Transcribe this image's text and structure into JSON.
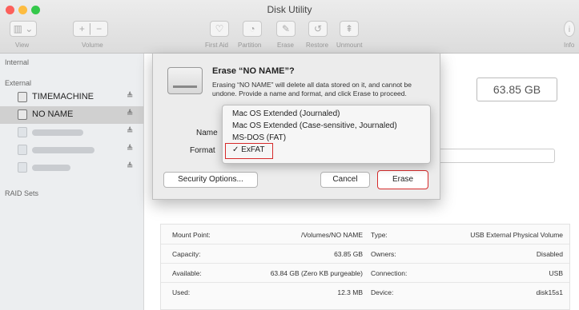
{
  "window": {
    "title": "Disk Utility"
  },
  "toolbar": {
    "view_label": "View",
    "volume_label": "Volume",
    "first_aid_label": "First Aid",
    "partition_label": "Partition",
    "erase_label": "Erase",
    "restore_label": "Restore",
    "unmount_label": "Unmount",
    "info_label": "Info"
  },
  "sidebar": {
    "internal_header": "Internal",
    "external_header": "External",
    "raid_header": "RAID Sets",
    "items": [
      {
        "label": "TIMEMACHINE"
      },
      {
        "label": "NO NAME"
      }
    ],
    "eject_glyph": "≜"
  },
  "main": {
    "capacity": "63.85 GB"
  },
  "dialog": {
    "title": "Erase “NO NAME”?",
    "body": "Erasing “NO NAME” will delete all data stored on it, and cannot be undone. Provide a name and format, and click Erase to proceed.",
    "name_label": "Name",
    "format_label": "Format",
    "security_button": "Security Options...",
    "cancel_button": "Cancel",
    "erase_button": "Erase"
  },
  "format_menu": {
    "options": [
      "Mac OS Extended (Journaled)",
      "Mac OS Extended (Case-sensitive, Journaled)",
      "MS-DOS (FAT)",
      "ExFAT"
    ],
    "selected": "ExFAT",
    "check_glyph": "✓"
  },
  "info": {
    "rows": [
      {
        "k1": "Mount Point:",
        "v1": "/Volumes/NO NAME",
        "k2": "Type:",
        "v2": "USB External Physical Volume"
      },
      {
        "k1": "Capacity:",
        "v1": "63.85 GB",
        "k2": "Owners:",
        "v2": "Disabled"
      },
      {
        "k1": "Available:",
        "v1": "63.84 GB (Zero KB purgeable)",
        "k2": "Connection:",
        "v2": "USB"
      },
      {
        "k1": "Used:",
        "v1": "12.3 MB",
        "k2": "Device:",
        "v2": "disk15s1"
      }
    ]
  },
  "colors": {
    "highlight": "#d62b2b",
    "selected_row": "#d0d0d0"
  }
}
